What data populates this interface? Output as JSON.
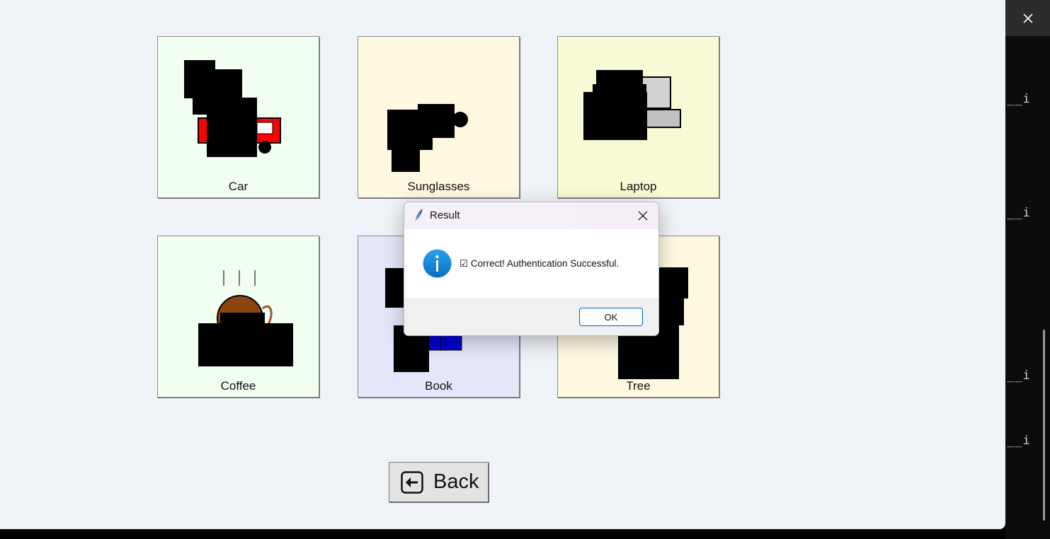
{
  "tiles": [
    {
      "label": "Car",
      "bg": "#f0fff0"
    },
    {
      "label": "Sunglasses",
      "bg": "#fff8e1"
    },
    {
      "label": "Laptop",
      "bg": "#f7fad4"
    },
    {
      "label": "Coffee",
      "bg": "#f0fff0"
    },
    {
      "label": "Book",
      "bg": "#e6e6fa"
    },
    {
      "label": "Tree",
      "bg": "#fff8e1"
    }
  ],
  "back_button": {
    "label": "Back",
    "icon": "arrow-left-icon"
  },
  "dialog": {
    "title": "Result",
    "message_check": "☑",
    "message": "Correct! Authentication Successful.",
    "ok_label": "OK",
    "icon": "info-icon"
  },
  "terminal": {
    "lines": [
      "__i",
      "__i",
      "__i",
      "__i"
    ]
  },
  "colors": {
    "app_bg": "#eff2f7",
    "accent": "#0067c0",
    "info_blue": "#1a8ee0"
  }
}
